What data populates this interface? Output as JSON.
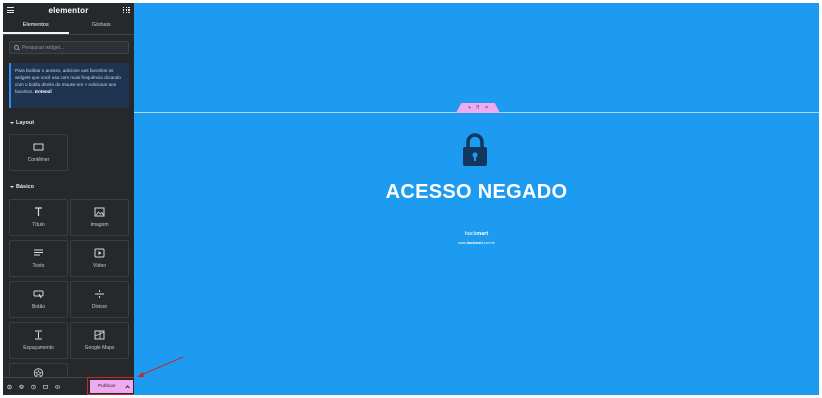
{
  "sidebar": {
    "logo": "elementor",
    "tabs": [
      "Elementos",
      "Globais"
    ],
    "search_placeholder": "Pesquisar widget...",
    "notice_text": "Para facilitar o acesso, adicione aos favoritos os widgets que você usa com mais frequência clicando com o botão direito do mouse em > Adicionar aos favoritos.",
    "notice_link": "Entendi",
    "layout_title": "Layout",
    "layout_widgets": [
      {
        "label": "Contêiner",
        "icon": "container-icon"
      }
    ],
    "basic_title": "Básico",
    "basic_widgets": [
      {
        "label": "Título",
        "icon": "heading-icon"
      },
      {
        "label": "Imagem",
        "icon": "image-icon"
      },
      {
        "label": "Texto",
        "icon": "text-editor-icon"
      },
      {
        "label": "Vídeo",
        "icon": "video-icon"
      },
      {
        "label": "Botão",
        "icon": "button-icon"
      },
      {
        "label": "Divisor",
        "icon": "divider-icon"
      },
      {
        "label": "Espaçamento",
        "icon": "spacer-icon"
      },
      {
        "label": "Google Maps",
        "icon": "map-icon"
      },
      {
        "label": "",
        "icon": "star-icon"
      }
    ],
    "footer_icons": [
      "settings-icon",
      "layers-icon",
      "history-icon",
      "responsive-icon",
      "preview-icon"
    ],
    "publish_label": "Publicar"
  },
  "canvas": {
    "background": "#1d9bf0",
    "section_handle": {
      "add": "+",
      "move": "⠿",
      "close": "×"
    },
    "headline": "ACESSO NEGADO",
    "brand_prefix": "hack",
    "brand_bold": "mart",
    "brand_url_prefix": "www.",
    "brand_url_bold": "hackmart",
    "brand_url_suffix": ".com.br"
  },
  "colors": {
    "sidebar_bg": "#26292c",
    "accent_pink": "#f0aaf0",
    "annotation_red": "#c42b2b"
  }
}
